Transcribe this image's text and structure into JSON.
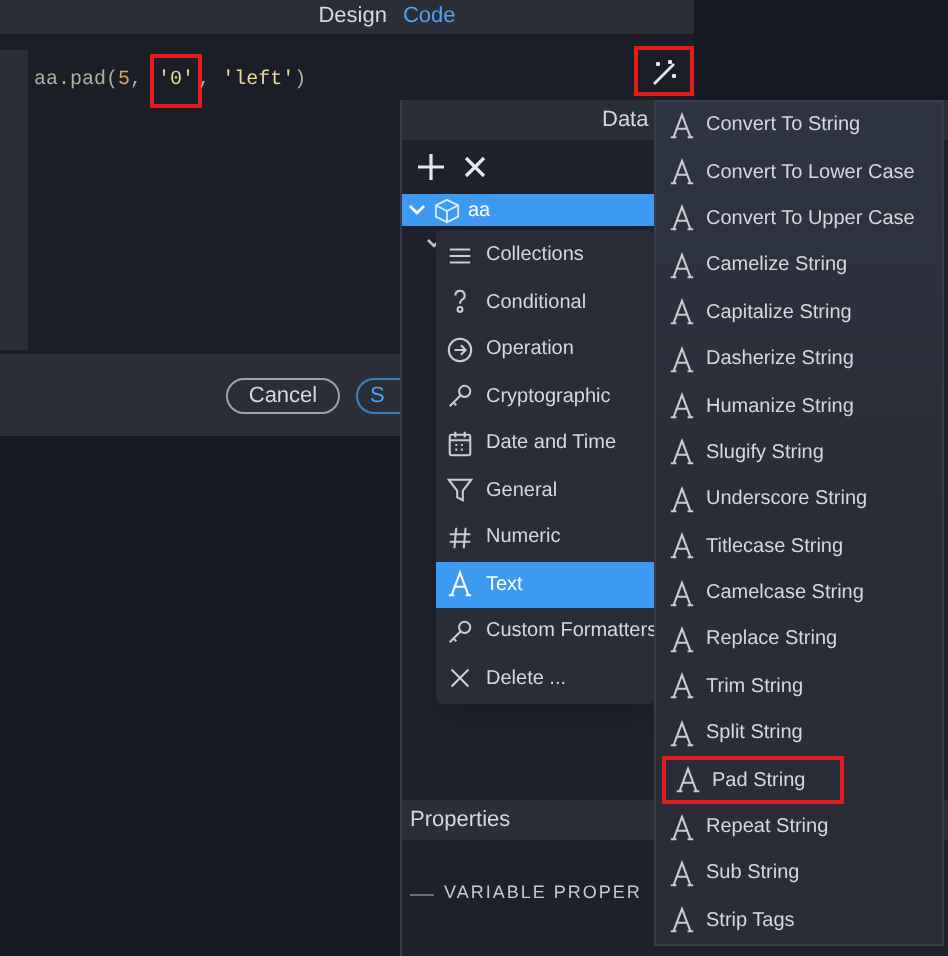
{
  "editor": {
    "tabs": [
      {
        "label": "Design",
        "selected": false
      },
      {
        "label": "Code",
        "selected": true
      }
    ],
    "code": [
      {
        "text": "aa.pad(",
        "kind": "plain",
        "highlighted": false
      },
      {
        "text": "5",
        "kind": "number",
        "highlighted": false
      },
      {
        "text": ", ",
        "kind": "plain",
        "highlighted": false
      },
      {
        "text": "'0'",
        "kind": "string",
        "highlighted": true
      },
      {
        "text": ", ",
        "kind": "plain",
        "highlighted": false
      },
      {
        "text": "'left'",
        "kind": "string",
        "highlighted": false
      },
      {
        "text": ")",
        "kind": "plain",
        "highlighted": false
      }
    ],
    "wand_highlighted": true,
    "buttons": [
      {
        "label": "Cancel",
        "kind": "secondary"
      },
      {
        "label": "S",
        "kind": "primary"
      }
    ]
  },
  "data_panel": {
    "title": "Data",
    "tree": [
      {
        "label": "aa",
        "selected": true,
        "expanded": true
      }
    ]
  },
  "context_menu": [
    {
      "label": "Collections",
      "kind": "lines",
      "selected": false
    },
    {
      "label": "Conditional",
      "kind": "question",
      "selected": false
    },
    {
      "label": "Operation",
      "kind": "arrow-circle",
      "selected": false
    },
    {
      "label": "Cryptographic",
      "kind": "key",
      "selected": false
    },
    {
      "label": "Date and Time",
      "kind": "calendar",
      "selected": false
    },
    {
      "label": "General",
      "kind": "funnel",
      "selected": false
    },
    {
      "label": "Numeric",
      "kind": "hash",
      "selected": false
    },
    {
      "label": "Text",
      "kind": "letter",
      "selected": true
    },
    {
      "label": "Custom Formatters",
      "kind": "key",
      "selected": false
    },
    {
      "label": "Delete ...",
      "kind": "x",
      "selected": false
    }
  ],
  "submenu": [
    {
      "label": "Convert To String",
      "highlighted": false
    },
    {
      "label": "Convert To Lower Case",
      "highlighted": false
    },
    {
      "label": "Convert To Upper Case",
      "highlighted": false
    },
    {
      "label": "Camelize String",
      "highlighted": false
    },
    {
      "label": "Capitalize String",
      "highlighted": false
    },
    {
      "label": "Dasherize String",
      "highlighted": false
    },
    {
      "label": "Humanize String",
      "highlighted": false
    },
    {
      "label": "Slugify String",
      "highlighted": false
    },
    {
      "label": "Underscore String",
      "highlighted": false
    },
    {
      "label": "Titlecase String",
      "highlighted": false
    },
    {
      "label": "Camelcase String",
      "highlighted": false
    },
    {
      "label": "Replace String",
      "highlighted": false
    },
    {
      "label": "Trim String",
      "highlighted": false
    },
    {
      "label": "Split String",
      "highlighted": false
    },
    {
      "label": "Pad String",
      "highlighted": true
    },
    {
      "label": "Repeat String",
      "highlighted": false
    },
    {
      "label": "Sub String",
      "highlighted": false
    },
    {
      "label": "Strip Tags",
      "highlighted": false
    }
  ],
  "properties": {
    "title": "Properties",
    "section": "VARIABLE PROPER"
  }
}
